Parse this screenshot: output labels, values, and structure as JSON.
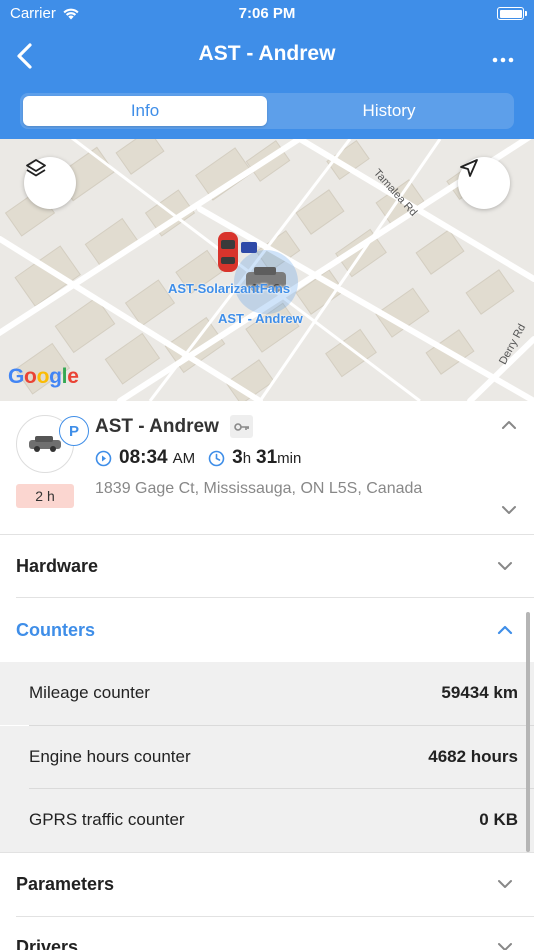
{
  "status_bar": {
    "carrier": "Carrier",
    "time": "7:06 PM"
  },
  "nav": {
    "title": "AST - Andrew",
    "more_icon": "ellipsis-icon",
    "back_icon": "chevron-left-icon"
  },
  "tabs": [
    {
      "label": "Info",
      "active": true
    },
    {
      "label": "History",
      "active": false
    }
  ],
  "map": {
    "streets": [
      "Tamalea Rd",
      "Derry Rd"
    ],
    "labels": [
      "AST-SolarizantFans",
      "AST - Andrew"
    ],
    "logo": "Google"
  },
  "vehicle": {
    "name": "AST - Andrew",
    "status_badge": "P",
    "duration": "2 h",
    "time_main": "08:34",
    "time_ampm": "AM",
    "elapsed_hours": "3",
    "elapsed_hours_unit": "h",
    "elapsed_minutes": "31",
    "elapsed_minutes_unit": "min",
    "address": "1839 Gage Ct, Mississauga, ON L5S, Canada"
  },
  "sections": {
    "hardware": "Hardware",
    "counters": "Counters",
    "parameters": "Parameters",
    "drivers": "Drivers"
  },
  "counters": [
    {
      "label": "Mileage counter",
      "value": "59434 km"
    },
    {
      "label": "Engine hours counter",
      "value": "4682 hours"
    },
    {
      "label": "GPRS traffic counter",
      "value": "0 KB"
    }
  ],
  "colors": {
    "accent": "#3f8ee8",
    "badge": "#fbd6d0"
  }
}
